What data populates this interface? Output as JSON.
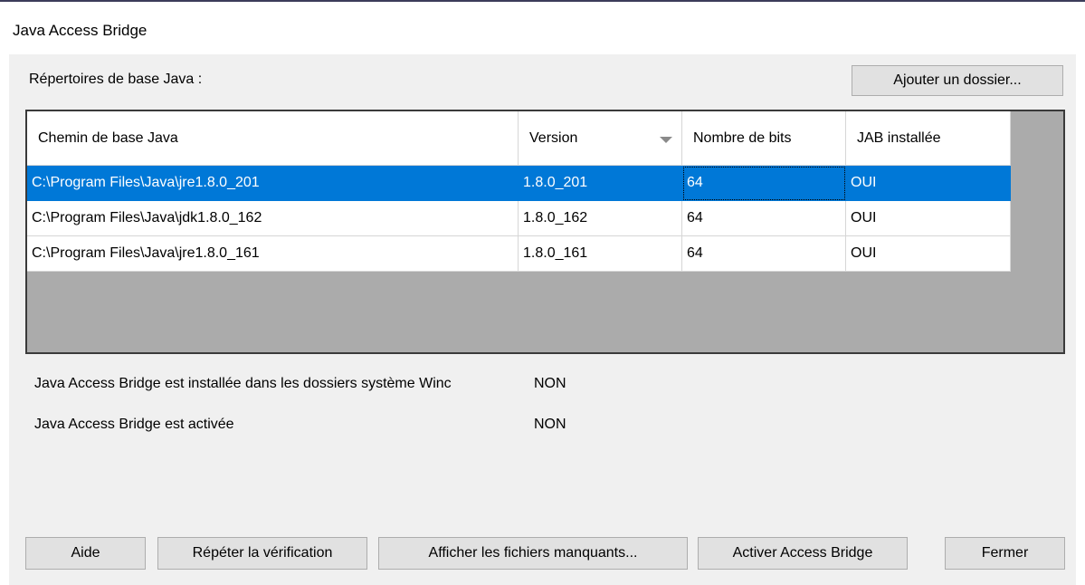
{
  "window": {
    "title": "Java Access Bridge"
  },
  "section_label": "Répertoires de base Java :",
  "add_folder_button": "Ajouter un dossier...",
  "table": {
    "columns": [
      "Chemin de base Java",
      "Version",
      "Nombre de bits",
      "JAB installée"
    ],
    "rows": [
      {
        "path": "C:\\Program Files\\Java\\jre1.8.0_201",
        "version": "1.8.0_201",
        "bits": "64",
        "jab": "OUI"
      },
      {
        "path": "C:\\Program Files\\Java\\jdk1.8.0_162",
        "version": "1.8.0_162",
        "bits": "64",
        "jab": "OUI"
      },
      {
        "path": "C:\\Program Files\\Java\\jre1.8.0_161",
        "version": "1.8.0_161",
        "bits": "64",
        "jab": "OUI"
      }
    ]
  },
  "status": {
    "installed_label": "Java Access Bridge est installée dans les dossiers système Winc",
    "installed_value": "NON",
    "enabled_label": "Java Access Bridge est activée",
    "enabled_value": "NON"
  },
  "buttons": {
    "help": "Aide",
    "recheck": "Répéter la vérification",
    "show_missing": "Afficher les fichiers manquants...",
    "enable": "Activer Access Bridge",
    "close": "Fermer"
  },
  "colors": {
    "selection": "#0078d7",
    "dialog_bg": "#f0f0f0",
    "grid_bg": "#ababab"
  }
}
